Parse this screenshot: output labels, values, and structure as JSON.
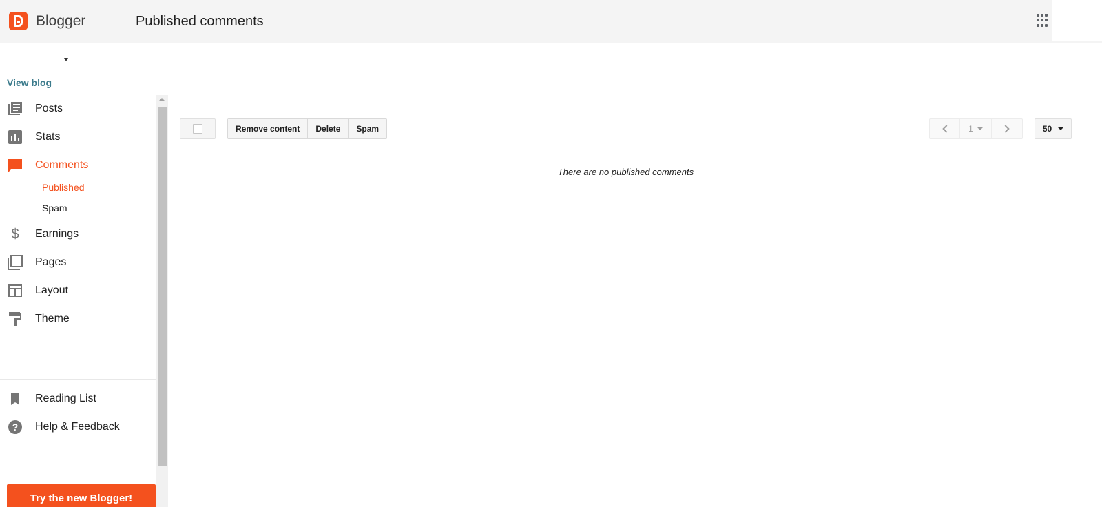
{
  "header": {
    "brand": "Blogger",
    "title": "Published comments"
  },
  "sidebar": {
    "view_blog": "View blog",
    "items": [
      {
        "label": "Posts",
        "icon": "posts-icon"
      },
      {
        "label": "Stats",
        "icon": "stats-icon"
      },
      {
        "label": "Comments",
        "icon": "comments-icon",
        "active": true
      },
      {
        "label": "Earnings",
        "icon": "dollar-icon"
      },
      {
        "label": "Pages",
        "icon": "pages-icon"
      },
      {
        "label": "Layout",
        "icon": "layout-icon"
      },
      {
        "label": "Theme",
        "icon": "paint-roller-icon"
      }
    ],
    "comments_sub": [
      {
        "label": "Published",
        "active": true
      },
      {
        "label": "Spam"
      }
    ],
    "footer_items": [
      {
        "label": "Reading List",
        "icon": "bookmark-icon"
      },
      {
        "label": "Help & Feedback",
        "icon": "help-icon"
      }
    ],
    "try_new": "Try the new Blogger!"
  },
  "toolbar": {
    "actions": [
      "Remove content",
      "Delete",
      "Spam"
    ],
    "page": "1",
    "per_page": "50"
  },
  "main": {
    "empty_message": "There are no published comments"
  },
  "colors": {
    "accent": "#f4511e",
    "view_blog": "#3c7b8c",
    "icon": "#757575"
  }
}
